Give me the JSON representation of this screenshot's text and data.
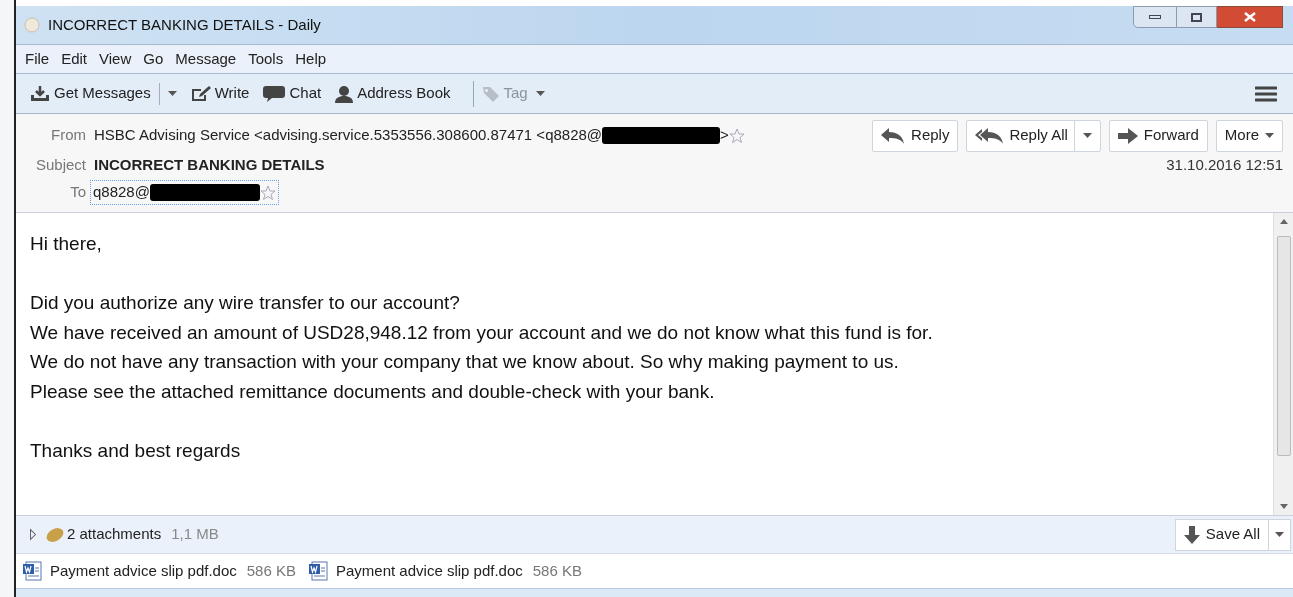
{
  "window": {
    "title": "INCORRECT BANKING DETAILS - Daily"
  },
  "menu": [
    "File",
    "Edit",
    "View",
    "Go",
    "Message",
    "Tools",
    "Help"
  ],
  "toolbar": [
    {
      "kind": "download",
      "label": "Get Messages",
      "dropdown": true,
      "disabled": false
    },
    {
      "kind": "write",
      "label": "Write",
      "dropdown": false,
      "disabled": false
    },
    {
      "kind": "chat",
      "label": "Chat",
      "dropdown": false,
      "disabled": false
    },
    {
      "kind": "person",
      "label": "Address Book",
      "dropdown": false,
      "disabled": false
    },
    {
      "kind": "tag",
      "label": "Tag",
      "dropdown": true,
      "disabled": true
    }
  ],
  "header": {
    "from_label": "From",
    "from": "HSBC Advising Service <advising.service.5353556.308600.87471 <q8828@",
    "from_end": ">",
    "subject_label": "Subject",
    "subject": "INCORRECT BANKING DETAILS",
    "to_label": "To",
    "to": "q8828@",
    "date": "31.10.2016 12:51"
  },
  "actions": [
    {
      "kind": "reply",
      "label": "Reply",
      "dropdown": false
    },
    {
      "kind": "replyall",
      "label": "Reply All",
      "dropdown": true
    },
    {
      "kind": "forward",
      "label": "Forward",
      "dropdown": false
    },
    {
      "kind": "more",
      "label": "More",
      "dropdown": true
    }
  ],
  "body": [
    [
      "Hi there,"
    ],
    [
      "Did you authorize any wire transfer to our account?",
      "We have received an amount of USD28,948.12 from your account and we do not know what this fund is for.",
      "We do not have any transaction with your company that we know about. So why making payment to us.",
      "Please see the attached remittance documents and double-check with your bank."
    ],
    [
      "Thanks and best regards"
    ]
  ],
  "attachments_bar": {
    "expanded": false,
    "count": "2 attachments",
    "size": "1,1 MB",
    "save_all": "Save All"
  },
  "attachments": [
    {
      "name": "Payment advice slip pdf.doc",
      "size": "586 KB"
    },
    {
      "name": "Payment advice slip pdf.doc",
      "size": "586 KB"
    }
  ]
}
